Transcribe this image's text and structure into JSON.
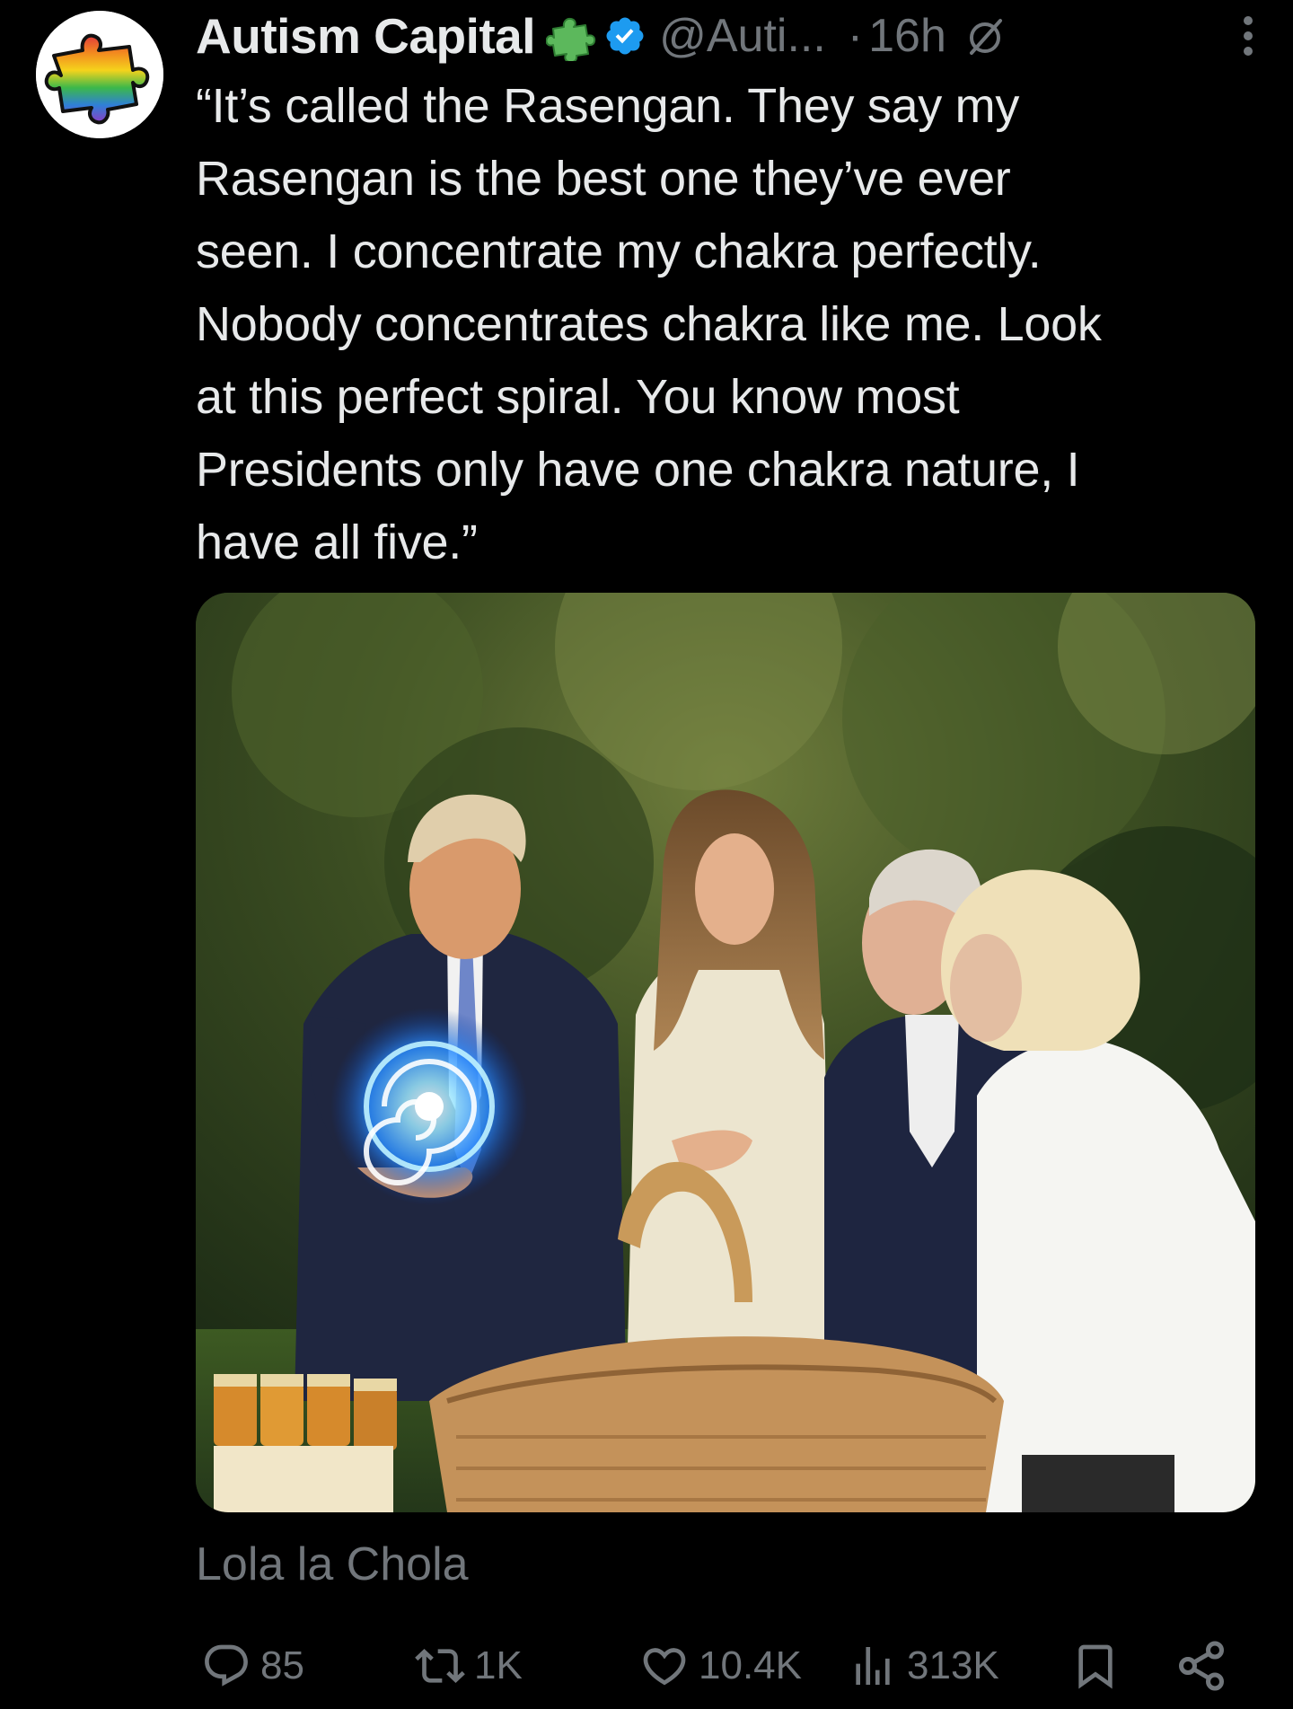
{
  "author": {
    "display_name": "Autism Capital",
    "name_emoji": "puzzle-piece-icon",
    "verified": true,
    "handle": "@Auti...",
    "separator": "·",
    "time": "16h"
  },
  "tweet": {
    "text": "“It’s called the Rasengan. They say my\nRasengan is the best one they’ve ever\nseen. I concentrate my chakra perfectly.\nNobody concentrates chakra like me. Look\nat this perfect spiral. You know most\nPresidents only have one chakra nature, I\nhave all five.”",
    "media_alt": "Edited photo of four people in a garden; one man holds a glowing blue spiral energy ball above his open palm beside a wicker basket and jars of honey",
    "credit": "Lola la Chola"
  },
  "actions": {
    "replies": "85",
    "reposts": "1K",
    "likes": "10.4K",
    "views": "313K"
  },
  "colors": {
    "background": "#000000",
    "text": "#e7e9ea",
    "secondary": "#71767b",
    "verified": "#1d9bf0",
    "puzzle_green": "#3a9d3a"
  }
}
